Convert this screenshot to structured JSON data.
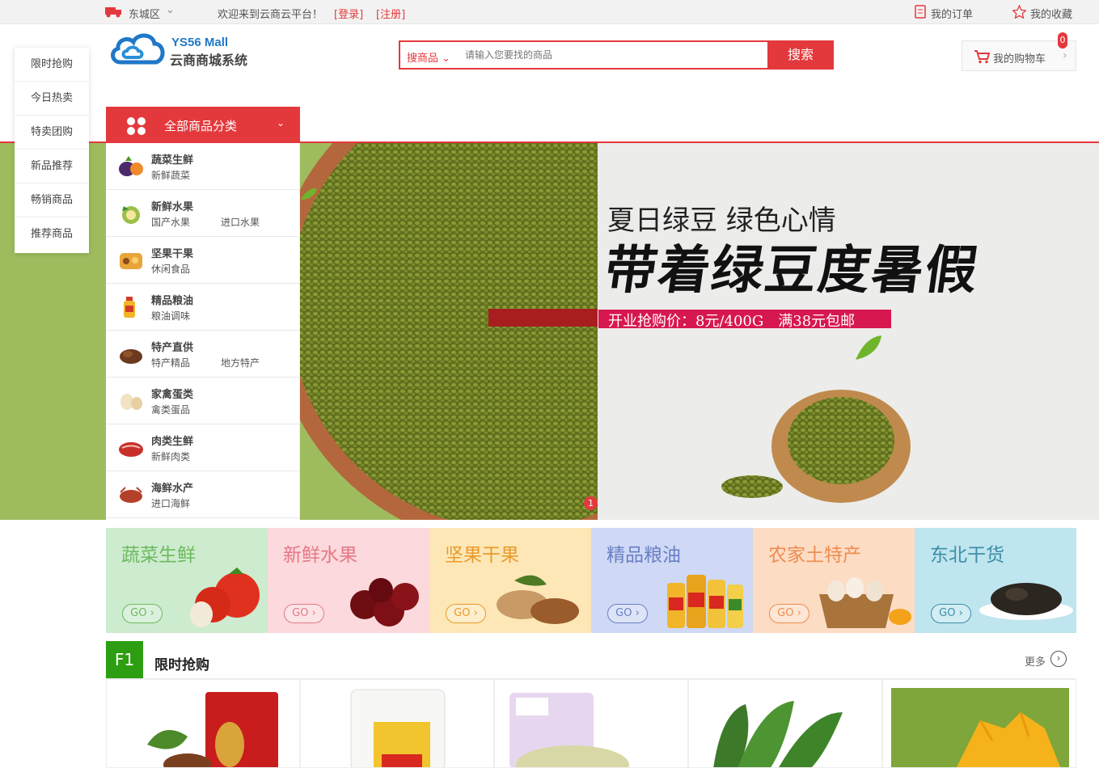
{
  "topbar": {
    "location": "东城区",
    "welcome": "欢迎来到云商云平台！",
    "login": "[登录]",
    "register": "[注册]",
    "orders": "我的订单",
    "favorites": "我的收藏"
  },
  "logo": {
    "en": "YS56 Mall",
    "cn": "云商商城系统"
  },
  "search": {
    "category": "搜商品",
    "placeholder": "请输入您要找的商品",
    "button": "搜索"
  },
  "cart": {
    "label": "我的购物车",
    "count": "0"
  },
  "sidenav": [
    "限时抢购",
    "今日热卖",
    "特卖团购",
    "新品推荐",
    "畅销商品",
    "推荐商品"
  ],
  "all_categories": "全部商品分类",
  "categories": [
    {
      "title": "蔬菜生鲜",
      "subs": [
        "新鲜蔬菜"
      ]
    },
    {
      "title": "新鲜水果",
      "subs": [
        "国产水果",
        "进口水果"
      ]
    },
    {
      "title": "坚果干果",
      "subs": [
        "休闲食品"
      ]
    },
    {
      "title": "精品粮油",
      "subs": [
        "粮油调味"
      ]
    },
    {
      "title": "特产直供",
      "subs": [
        "特产精品",
        "地方特产"
      ]
    },
    {
      "title": "家禽蛋类",
      "subs": [
        "禽类蛋品"
      ]
    },
    {
      "title": "肉类生鲜",
      "subs": [
        "新鲜肉类"
      ]
    },
    {
      "title": "海鲜水产",
      "subs": [
        "进口海鲜"
      ]
    }
  ],
  "banner": {
    "line1": "夏日绿豆 绿色心情",
    "line2": "带着绿豆度暑假",
    "price": "开业抢购价：8元/400G　满38元包邮",
    "dot": "1"
  },
  "tiles": [
    {
      "title": "蔬菜生鲜",
      "go": "GO ›",
      "bg": "#cdebcf",
      "color": "#6cba5e"
    },
    {
      "title": "新鲜水果",
      "go": "GO ›",
      "bg": "#fbd9dc",
      "color": "#e57887"
    },
    {
      "title": "坚果干果",
      "go": "GO ›",
      "bg": "#fde7b6",
      "color": "#ea9b2c"
    },
    {
      "title": "精品粮油",
      "go": "GO ›",
      "bg": "#cfd9f5",
      "color": "#6a7fc4"
    },
    {
      "title": "农家土特产",
      "go": "GO ›",
      "bg": "#fddcc4",
      "color": "#ee8c4e"
    },
    {
      "title": "东北干货",
      "go": "GO ›",
      "bg": "#bfe5ef",
      "color": "#3d8ea6"
    }
  ],
  "floor": {
    "num": "F1",
    "title": "限时抢购",
    "more": "更多"
  }
}
